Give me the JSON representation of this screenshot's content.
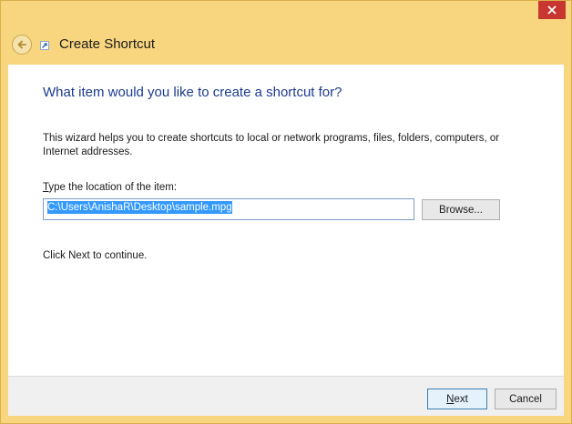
{
  "window": {
    "title": "Create Shortcut"
  },
  "page": {
    "heading": "What item would you like to create a shortcut for?",
    "description": "This wizard helps you to create shortcuts to local or network programs, files, folders, computers, or Internet addresses.",
    "location_label_access_key": "T",
    "location_label_rest": "ype the location of the item:",
    "location_value": "C:\\Users\\AnishaR\\Desktop\\sample.mpg",
    "browse_label": "Browse...",
    "continue_text": "Click Next to continue."
  },
  "footer": {
    "next_access_key": "N",
    "next_rest": "ext",
    "cancel_label": "Cancel"
  },
  "icons": {
    "close": "close-icon",
    "back": "back-arrow-icon",
    "shortcut": "shortcut-icon"
  },
  "colors": {
    "frame": "#f8d67f",
    "close_button": "#c7372f",
    "heading": "#1c3b8e",
    "selection": "#3399ff"
  }
}
